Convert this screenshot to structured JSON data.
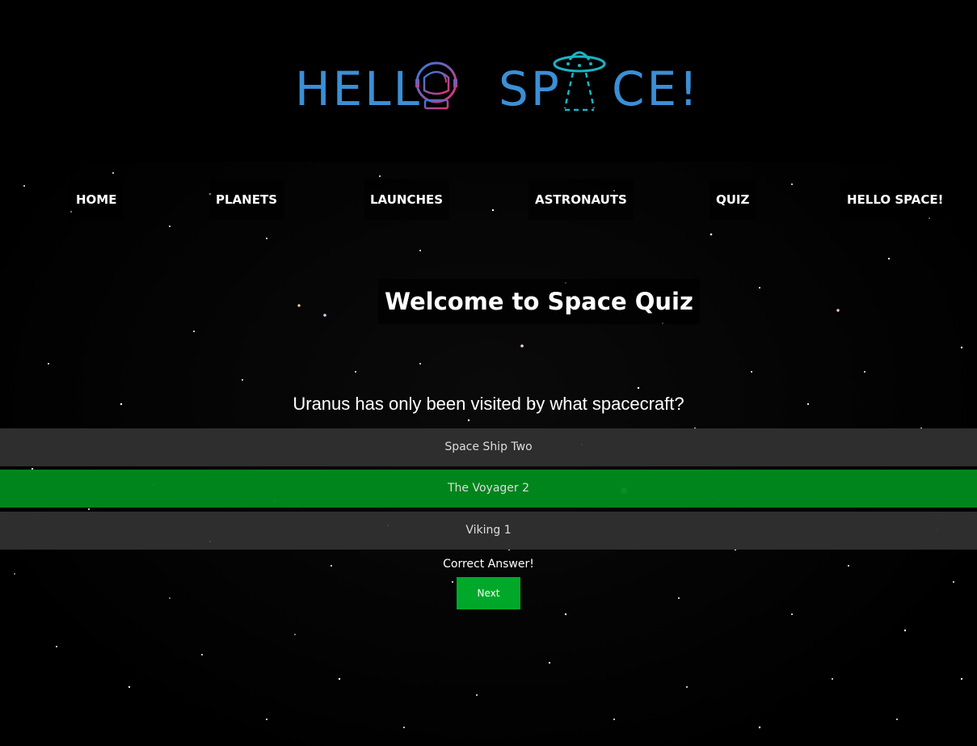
{
  "logo": {
    "part1": "HELL",
    "part2": "SP",
    "part3": "CE!"
  },
  "nav": [
    "HOME",
    "PLANETS",
    "LAUNCHES",
    "ASTRONAUTS",
    "QUIZ",
    "HELLO SPACE!"
  ],
  "quiz": {
    "title": "Welcome to Space Quiz",
    "question": "Uranus has only been visited by what spacecraft?",
    "answers": [
      "Space Ship Two",
      "The Voyager 2",
      "Viking 1"
    ],
    "selected_answer_state": "correct",
    "feedback": "Correct Answer!",
    "next_label": "Next"
  },
  "colors": {
    "logo_blue": "#3b8fd6",
    "helmet_gradient_start": "#2f7de0",
    "helmet_gradient_end": "#e03174",
    "ufo_teal": "#18b5c6",
    "correct_green": "#008c1e",
    "next_green": "#00a82a"
  }
}
